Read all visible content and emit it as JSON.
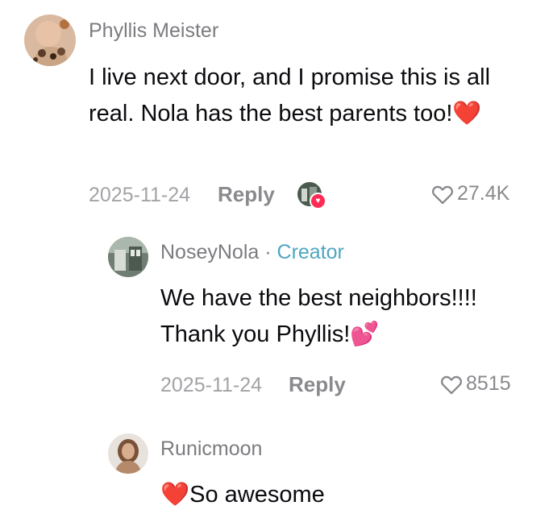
{
  "comments": [
    {
      "username": "Phyllis Meister",
      "text": "I live next door, and I promise this is all real. Nola has the best parents too!",
      "emoji": "❤️",
      "date": "2025-11-24",
      "reply_label": "Reply",
      "likes": "27.4K"
    },
    {
      "username": "NoseyNola",
      "separator": "·",
      "badge": "Creator",
      "text": "We have the best neighbors!!!! Thank you Phyllis!",
      "emoji": "💕",
      "date": "2025-11-24",
      "reply_label": "Reply",
      "likes": "8515"
    },
    {
      "username": "Runicmoon",
      "emoji": "❤️",
      "text": "So awesome"
    }
  ],
  "colors": {
    "username": "#7c7c80",
    "creator_tag": "#4fa6c2",
    "meta": "#a3a3a7",
    "like_badge": "#fe2c55"
  },
  "icons": [
    "heart-outline-icon",
    "liked-by-avatar-icon",
    "heart-badge-icon"
  ]
}
